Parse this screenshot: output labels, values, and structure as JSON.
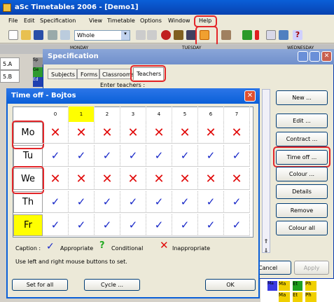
{
  "window": {
    "title": "aSc Timetables 2006   - [Demo1]"
  },
  "menu": [
    "File",
    "Edit",
    "Specification",
    "View",
    "Timetable",
    "Options",
    "Window",
    "Help"
  ],
  "toolbar": {
    "view_select": "Whole"
  },
  "bg": {
    "col1": "MONDAY",
    "col2": "TUESDAY",
    "col3": "WEDNESDAY",
    "rows": [
      "5.A",
      "5.B"
    ],
    "cells": [
      "Sp",
      "Ge",
      "Ed"
    ],
    "bottom_cells": [
      "Ma",
      "Ma",
      "Et",
      "Ph",
      "Ma",
      "Et",
      "Ph"
    ]
  },
  "spec": {
    "title": "Specification",
    "tabs": [
      "Subjects",
      "Forms",
      "Classrooms",
      "Teachers"
    ],
    "enter_label": "Enter teachers :",
    "buttons": [
      "New ...",
      "Edit ...",
      "Contract ...",
      "Time off ...",
      "Colour ...",
      "Details",
      "Remove",
      "Colour all"
    ],
    "cancel": "Cancel",
    "apply": "Apply"
  },
  "dlg": {
    "title": "Time off - Bojtos",
    "columns": [
      "0",
      "1",
      "2",
      "3",
      "4",
      "5",
      "6",
      "7"
    ],
    "days": [
      {
        "label": "Mo",
        "marks": [
          "x",
          "x",
          "x",
          "x",
          "x",
          "x",
          "x",
          "x"
        ]
      },
      {
        "label": "Tu",
        "marks": [
          "c",
          "c",
          "c",
          "c",
          "c",
          "c",
          "c",
          "c"
        ]
      },
      {
        "label": "We",
        "marks": [
          "x",
          "x",
          "x",
          "x",
          "x",
          "x",
          "x",
          "x"
        ]
      },
      {
        "label": "Th",
        "marks": [
          "c",
          "c",
          "c",
          "c",
          "c",
          "c",
          "c",
          "c"
        ]
      },
      {
        "label": "Fr",
        "marks": [
          "c",
          "c",
          "c",
          "c",
          "c",
          "c",
          "c",
          "c"
        ]
      }
    ],
    "caption": "Caption :",
    "appropriate": "Appropriate",
    "conditional": "Conditional",
    "inappropriate": "Inappropriate",
    "hint": "Use left and right mouse buttons to set.",
    "set_for_all": "Set for all",
    "cycle": "Cycle ...",
    "ok": "OK",
    "colors": {
      "highlight": "#ffff00",
      "cross": "#e10b0b",
      "check": "#1727c8",
      "cond": "#22aa22"
    }
  }
}
